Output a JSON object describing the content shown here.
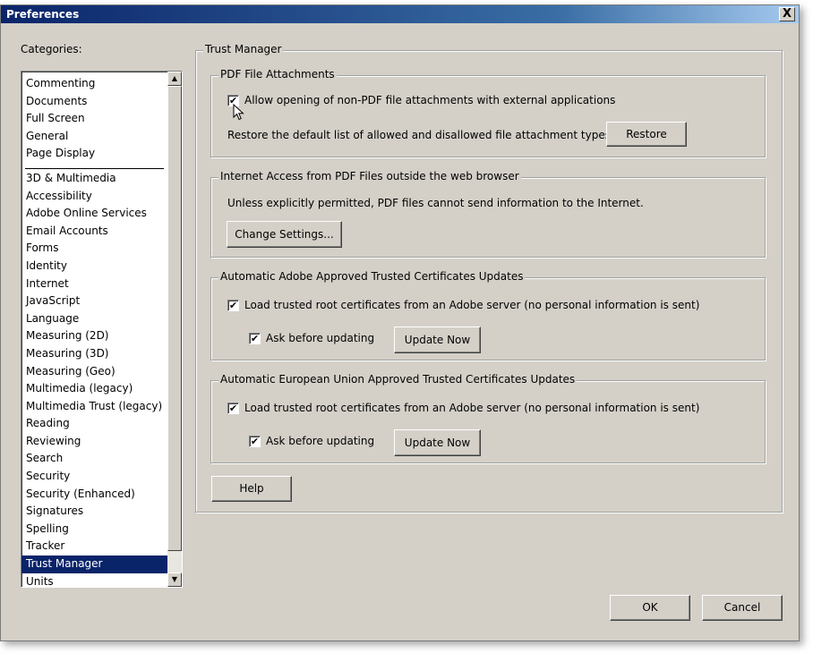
{
  "window": {
    "title": "Preferences",
    "close_glyph": "X"
  },
  "categories": {
    "label": "Categories:",
    "top_items": [
      "Commenting",
      "Documents",
      "Full Screen",
      "General",
      "Page Display"
    ],
    "items": [
      "3D & Multimedia",
      "Accessibility",
      "Adobe Online Services",
      "Email Accounts",
      "Forms",
      "Identity",
      "Internet",
      "JavaScript",
      "Language",
      "Measuring (2D)",
      "Measuring (3D)",
      "Measuring (Geo)",
      "Multimedia (legacy)",
      "Multimedia Trust (legacy)",
      "Reading",
      "Reviewing",
      "Search",
      "Security",
      "Security (Enhanced)",
      "Signatures",
      "Spelling",
      "Tracker",
      "Trust Manager",
      "Units"
    ],
    "selected": "Trust Manager"
  },
  "panel": {
    "title": "Trust Manager",
    "pdf_attachments": {
      "legend": "PDF File Attachments",
      "allow_label": "Allow opening of non-PDF file attachments with external applications",
      "allow_checked": true,
      "restore_text": "Restore the default list of allowed and disallowed file attachment types:",
      "restore_button": "Restore"
    },
    "internet_access": {
      "legend": "Internet Access from PDF Files outside the web browser",
      "info_text": "Unless explicitly permitted, PDF files cannot send information to the Internet.",
      "change_button": "Change Settings..."
    },
    "adobe_certs": {
      "legend": "Automatic Adobe Approved Trusted Certificates Updates",
      "load_label": "Load trusted root certificates from an Adobe server (no personal information is sent)",
      "load_checked": true,
      "ask_label": "Ask before updating",
      "ask_checked": true,
      "update_button": "Update Now"
    },
    "eu_certs": {
      "legend": "Automatic European Union Approved Trusted Certificates Updates",
      "load_label": "Load trusted root certificates from an Adobe server (no personal information is sent)",
      "load_checked": true,
      "ask_label": "Ask before updating",
      "ask_checked": true,
      "update_button": "Update Now"
    },
    "help_button": "Help"
  },
  "footer": {
    "ok_button": "OK",
    "cancel_button": "Cancel"
  },
  "icons": {
    "check_glyph": "✔",
    "scroll_up": "▲",
    "scroll_down": "▼"
  }
}
